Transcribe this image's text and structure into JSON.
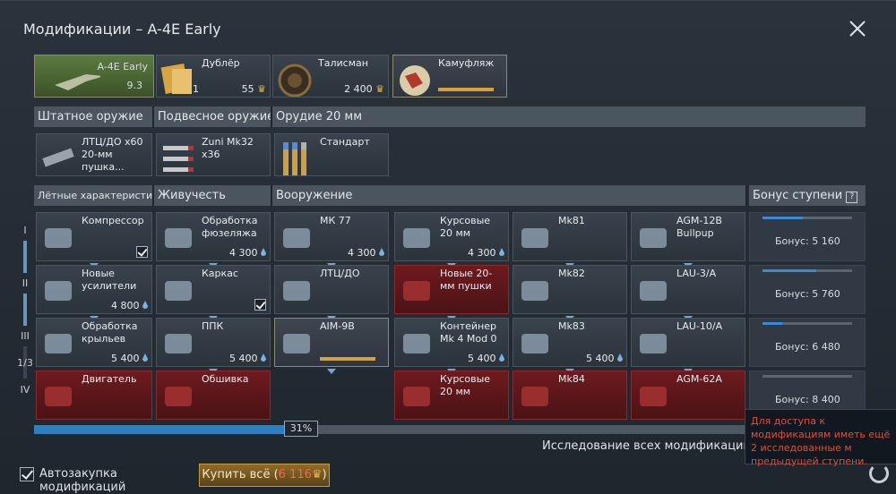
{
  "window": {
    "title": "Модификации – A-4E Early"
  },
  "crew": [
    {
      "name": "A-4E Early",
      "value": "9.3"
    },
    {
      "name": "Дублёр",
      "value_left": "1",
      "value": "55"
    },
    {
      "name": "Талисман",
      "value": "2 400"
    },
    {
      "name": "Камуфляж",
      "value": ""
    }
  ],
  "weapon_headers": [
    "Штатное оружие",
    "Подвесное оружие",
    "Орудие 20 мм"
  ],
  "weapons": [
    {
      "label": "ЛТЦ/ДО x60 20-мм пушка..."
    },
    {
      "label": "Zuni Mk32 x36"
    },
    {
      "label": "Стандарт"
    }
  ],
  "mod_headers": [
    "Лётные характеристики",
    "Живучесть",
    "Вооружение",
    "Бонус ступени"
  ],
  "tiers": [
    "I",
    "II",
    "III",
    "IV"
  ],
  "tier_counter": "1/3",
  "grid": [
    [
      "Компрессор",
      "Обработка фюзеляжа",
      "МК 77",
      "Курсовые 20 мм",
      "Mk81",
      "AGM-12B Bullpup"
    ],
    [
      "Новые усилители",
      "Каркас",
      "ЛТЦ/ДО",
      "Новые 20-мм пушки",
      "Mk82",
      "LAU-3/A"
    ],
    [
      "Обработка крыльев",
      "ППК",
      "AIM-9B",
      "Контейнер Mk 4 Mod 0",
      "Mk83",
      "LAU-10/A"
    ],
    [
      "Двигатель",
      "Обшивка",
      "",
      "Курсовые 20 мм",
      "Mk84",
      "AGM-62A"
    ]
  ],
  "grid_values": [
    [
      "",
      "4 300",
      "4 300",
      "4 300",
      "",
      ""
    ],
    [
      "4 800",
      "",
      "",
      "",
      "",
      ""
    ],
    [
      "5 400",
      "5 400",
      "",
      "5 400",
      "5 400",
      ""
    ],
    [
      "",
      "",
      "",
      "",
      "",
      ""
    ]
  ],
  "bonuses": [
    "Бонус: 5 160",
    "Бонус: 5 760",
    "Бонус: 6 480",
    "Бонус: 8 400"
  ],
  "bonus_progress": [
    0.45,
    0.6,
    0.22,
    0
  ],
  "progress": {
    "percent_label": "31%",
    "value": 0.31
  },
  "research_label": "Исследование всех модификаций:",
  "tooltip": "Для доступа к модификациям иметь ещё 2 исследованные м предыдущей ступени.",
  "autobuy_label": "Автозакупка модификаций",
  "buyall": {
    "label": "Купить всё (",
    "cost": "6 116",
    "close": ")"
  },
  "colors": {
    "accent": "#2d7fc0",
    "locked": "#6e1a1e",
    "gold": "#d9a13a"
  }
}
